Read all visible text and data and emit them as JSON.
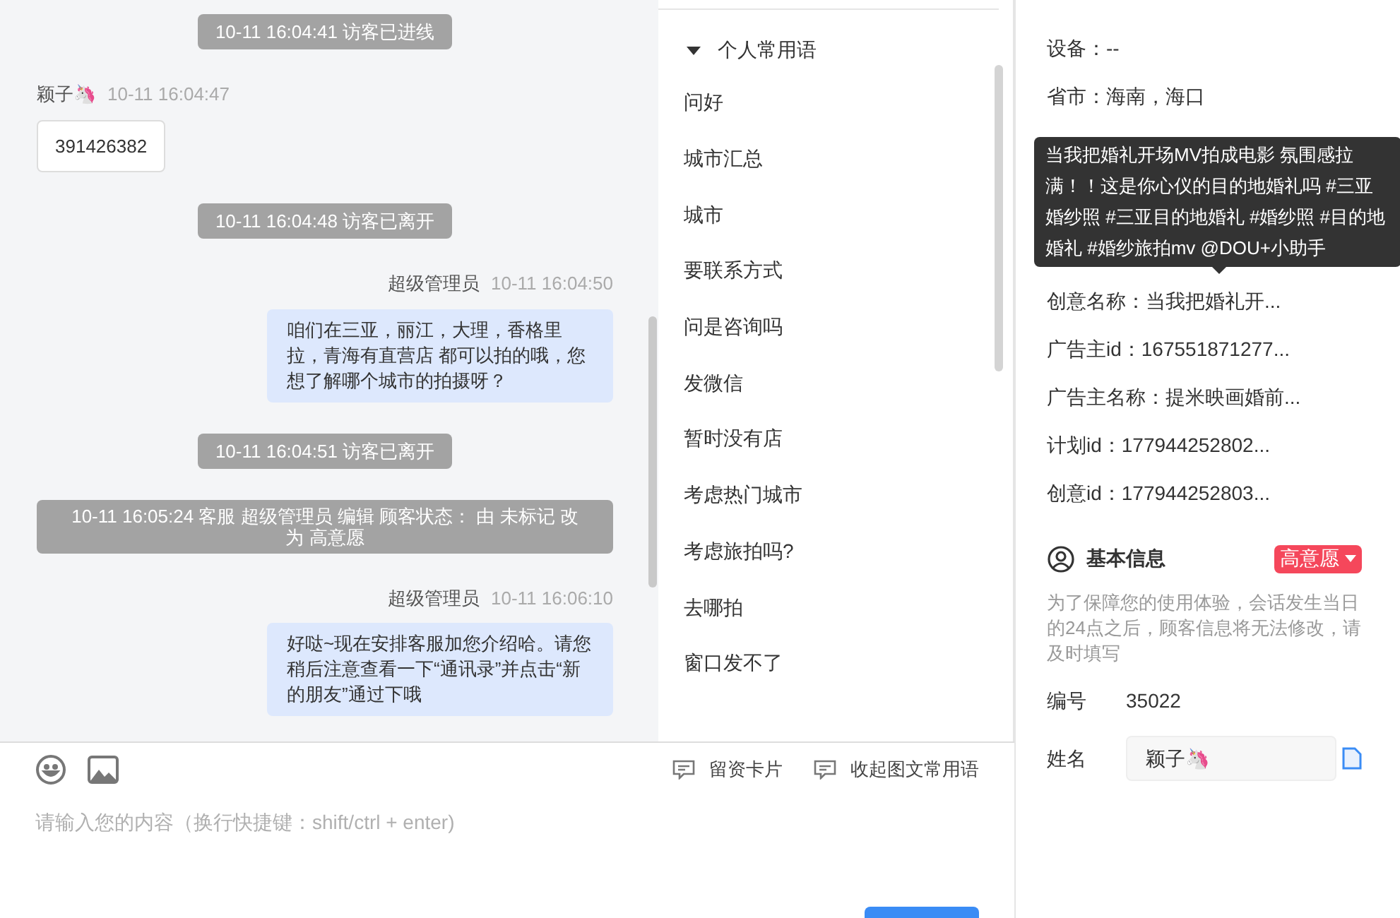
{
  "chat": {
    "messages": [
      {
        "kind": "system",
        "text": "10-11 16:04:41 访客已进线"
      },
      {
        "kind": "visitor",
        "sender": "颖子🦄",
        "time": "10-11 16:04:47",
        "text": "391426382"
      },
      {
        "kind": "system",
        "text": "10-11 16:04:48 访客已离开"
      },
      {
        "kind": "agent",
        "sender": "超级管理员",
        "time": "10-11 16:04:50",
        "text": "咱们在三亚，丽江，大理，香格里拉，青海有直营店 都可以拍的哦，您想了解哪个城市的拍摄呀？"
      },
      {
        "kind": "system",
        "text": "10-11 16:04:51 访客已离开"
      },
      {
        "kind": "status_change",
        "text": "10-11 16:05:24 客服 超级管理员 编辑 顾客状态： 由 未标记 改为 高意愿"
      },
      {
        "kind": "agent",
        "sender": "超级管理员",
        "time": "10-11 16:06:10",
        "text": "好哒~现在安排客服加您介绍哈。请您稍后注意查看一下“通讯录”并点击“新的朋友”通过下哦"
      }
    ]
  },
  "quick_phrases": {
    "group": {
      "label": "个人常用语",
      "expanded": true
    },
    "items": [
      "问好",
      "城市汇总",
      "城市",
      "要联系方式",
      "问是咨询吗",
      "发微信",
      "暂时没有店",
      "考虑热门城市",
      "考虑旅拍吗?",
      "去哪拍",
      "窗口发不了"
    ]
  },
  "composer": {
    "actions": [
      {
        "label": "留资卡片"
      },
      {
        "label": "收起图文常用语"
      }
    ],
    "placeholder": "请输入您的内容（换行快捷键：shift/ctrl + enter)"
  },
  "ad_info": {
    "rows_above": [
      "设备：--",
      "省市：海南，海口"
    ],
    "rows_below": [
      "创意名称：当我把婚礼开...",
      "广告主id：167551871277...",
      "广告主名称：提米映画婚前...",
      "计划id：177944252802...",
      "创意id：177944252803..."
    ],
    "tooltip": "当我把婚礼开场MV拍成电影 氛围感拉满！！这是你心仪的目的地婚礼吗 #三亚婚纱照 #三亚目的地婚礼 #婚纱照 #目的地婚礼 #婚纱旅拍mv @DOU+小助手"
  },
  "basic_info": {
    "title": "基本信息",
    "status": {
      "label": "高意愿",
      "color": "#f5475b"
    },
    "notice": "为了保障您的使用体验，会话发生当日的24点之后，顾客信息将无法修改，请及时填写",
    "fields": [
      {
        "kind": "text",
        "label": "编号",
        "value": "35022"
      },
      {
        "kind": "input",
        "label": "姓名",
        "value": "颖子🦄"
      }
    ]
  }
}
